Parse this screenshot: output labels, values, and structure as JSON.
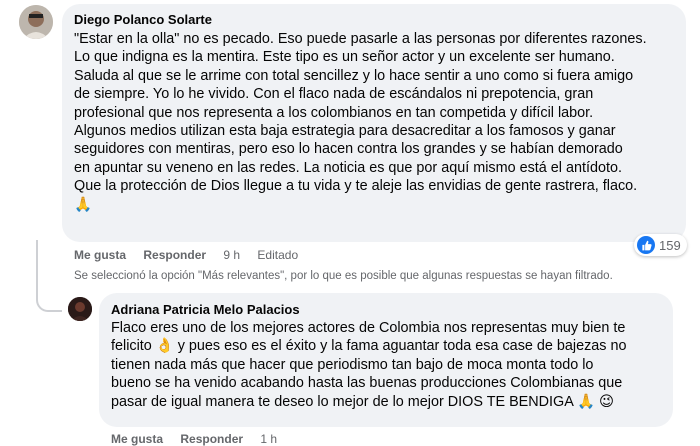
{
  "comment1": {
    "author": "Diego Polanco Solarte",
    "lines": [
      "\"Estar en la olla\" no es pecado. Eso puede pasarle a las personas por diferentes razones.",
      "Lo que indigna es la mentira. Este tipo es un señor actor y un excelente ser humano.",
      "Saluda al que se le arrime con total sencillez y lo hace sentir a uno como si fuera amigo",
      "de siempre. Yo lo he vivido. Con el flaco nada de escándalos ni prepotencia, gran",
      "profesional que nos representa a los colombianos en tan competida y difícil labor.",
      "Algunos medios utilizan esta baja estrategia para desacreditar a los famosos y ganar",
      "seguidores con mentiras, pero eso lo hacen contra los grandes y se habían demorado",
      "en apuntar su veneno en las redes. La noticia es que por aquí mismo está el antídoto.",
      "Que la protección de Dios llegue a tu vida y te aleje las envidias de gente rastrera, flaco.",
      "🙏"
    ],
    "like_label": "Me gusta",
    "reply_label": "Responder",
    "time": "9 h",
    "edited": "Editado",
    "reaction_count": "159",
    "reaction_icon": "like-thumb-icon"
  },
  "notice": "Se seleccionó la opción \"Más relevantes\", por lo que es posible que algunas respuestas se hayan filtrado.",
  "comment2": {
    "author": "Adriana Patricia Melo Palacios",
    "lines": [
      "Flaco eres uno de los mejores actores de Colombia nos representas muy bien te",
      "felicito 👌 y pues eso es el éxito y la fama aguantar toda esa case de bajezas no",
      "tienen nada más que hacer que periodismo tan bajo de moca monta todo lo",
      "bueno se ha venido acabando hasta las buenas producciones Colombianas que",
      "pasar de igual manera te deseo lo mejor de lo mejor DIOS TE BENDIGA 🙏 😉"
    ],
    "like_label": "Me gusta",
    "reply_label": "Responder",
    "time": "1 h"
  },
  "colors": {
    "bubble": "#f0f2f5",
    "meta_text": "#65676b",
    "like_blue": "#1877f2"
  }
}
